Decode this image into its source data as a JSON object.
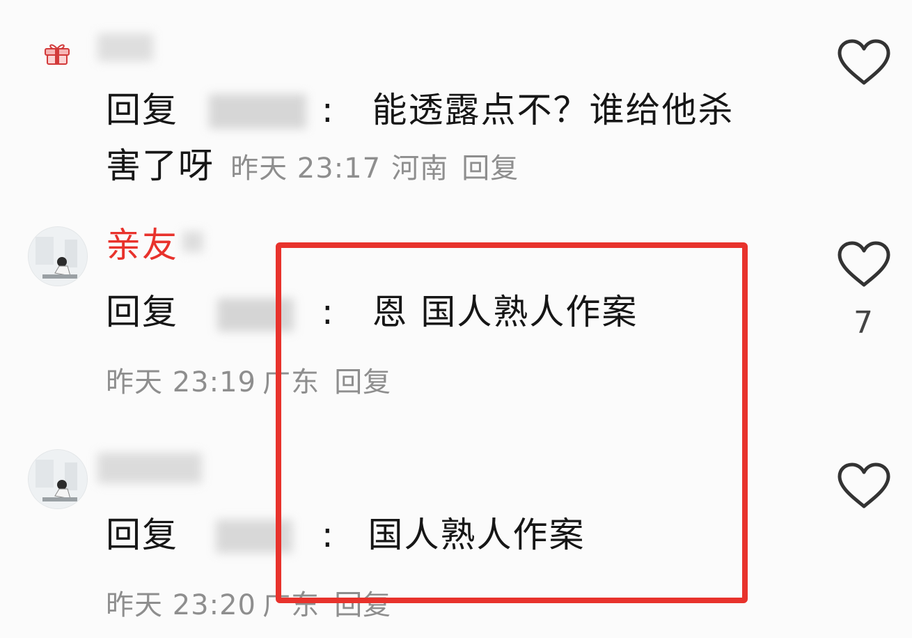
{
  "comments": [
    {
      "reply_prefix": "回复",
      "separator": ":",
      "text_line1": "能透露点不？谁给他杀",
      "text_line2": "害了呀",
      "time": "昨天 23:17",
      "location": "河南",
      "reply_label": "回复"
    },
    {
      "username": "亲友",
      "reply_prefix": "回复",
      "separator": ":",
      "text": "恩 国人熟人作案",
      "time": "昨天 23:19",
      "location": "广东",
      "reply_label": "回复",
      "like_count": "7"
    },
    {
      "reply_prefix": "回复",
      "separator": ":",
      "text": "国人熟人作案",
      "time": "昨天 23:20",
      "location": "广东",
      "reply_label": "回复"
    }
  ],
  "colors": {
    "username_accent": "#e8322c",
    "highlight_frame": "#e8322c",
    "meta_text": "#8e8e8e"
  },
  "icons": [
    "gift-icon",
    "heart-outline-icon",
    "avatar-photo"
  ]
}
